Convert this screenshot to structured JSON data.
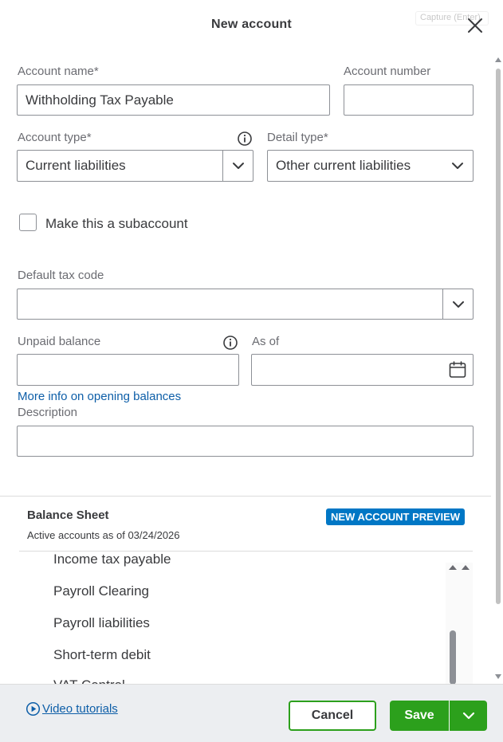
{
  "header": {
    "title": "New account",
    "capture_hint": "Capture (Enter)"
  },
  "form": {
    "account_name": {
      "label": "Account name*",
      "value": "Withholding Tax Payable"
    },
    "account_number": {
      "label": "Account number",
      "value": ""
    },
    "account_type": {
      "label": "Account type*",
      "value": "Current liabilities"
    },
    "detail_type": {
      "label": "Detail type*",
      "value": "Other current liabilities"
    },
    "subaccount": {
      "label": "Make this a subaccount",
      "checked": false
    },
    "default_tax_code": {
      "label": "Default tax code",
      "value": ""
    },
    "unpaid_balance": {
      "label": "Unpaid balance",
      "value": ""
    },
    "as_of": {
      "label": "As of",
      "value": ""
    },
    "opening_balances_link": "More info on opening balances",
    "description": {
      "label": "Description",
      "value": ""
    }
  },
  "balance_sheet": {
    "title": "Balance Sheet",
    "subtitle": "Active accounts as of 03/24/2026",
    "badge": "NEW ACCOUNT PREVIEW",
    "accounts": [
      "Income tax payable",
      "Payroll Clearing",
      "Payroll liabilities",
      "Short-term debit",
      "VAT Control"
    ]
  },
  "footer": {
    "video_tutorials": "Video tutorials",
    "cancel": "Cancel",
    "save": "Save"
  },
  "colors": {
    "primary_green": "#2ca01c",
    "link_blue": "#0d5ea8",
    "badge_blue": "#0077c5"
  }
}
